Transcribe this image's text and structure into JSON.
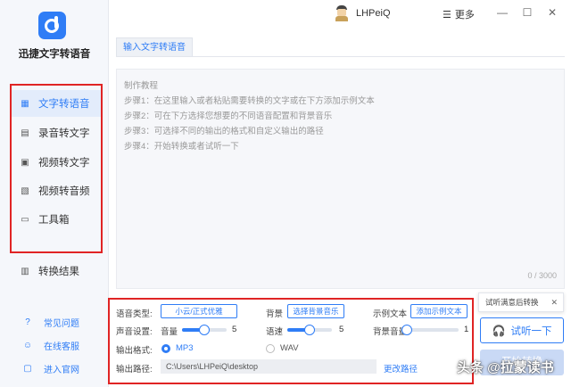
{
  "app": {
    "name": "迅捷文字转语音",
    "accent_color": "#2f7df6",
    "highlight_box_color": "#e02424"
  },
  "header": {
    "username": "LHPeiQ",
    "more_label": "更多",
    "icons": [
      "avatar",
      "menu-icon",
      "minimize-icon",
      "maximize-icon",
      "close-icon"
    ]
  },
  "sidebar": {
    "items": [
      {
        "label": "文字转语音",
        "icon": "text-to-speech-icon",
        "active": true
      },
      {
        "label": "录音转文字",
        "icon": "recording-icon",
        "active": false
      },
      {
        "label": "视频转文字",
        "icon": "video-text-icon",
        "active": false
      },
      {
        "label": "视频转音频",
        "icon": "video-audio-icon",
        "active": false
      },
      {
        "label": "工具箱",
        "icon": "toolbox-icon",
        "active": false
      }
    ],
    "result_label": "转换结果",
    "links": [
      {
        "label": "常见问题",
        "icon": "question-icon"
      },
      {
        "label": "在线客服",
        "icon": "service-icon"
      },
      {
        "label": "进入官网",
        "icon": "website-icon"
      }
    ]
  },
  "tab": {
    "label": "输入文字转语音"
  },
  "editor": {
    "placeholder_lines": [
      "制作教程",
      "步骤1：在这里输入或者粘贴需要转换的文字或在下方添加示例文本",
      "步骤2：可在下方选择您想要的不同语音配置和背景音乐",
      "步骤3：可选择不同的输出的格式和自定义输出的路径",
      "步骤4：开始转换或者试听一下"
    ],
    "counter": "0 / 3000"
  },
  "settings": {
    "voice_type_label": "语音类型:",
    "voice_type_value": "小云/正式优雅",
    "bg_label": "背景",
    "bg_button": "选择背景音乐",
    "sample_label": "示例文本",
    "sample_button": "添加示例文本",
    "sound_label": "声音设置:",
    "volume_label": "音量",
    "volume_value": "5",
    "volume_fraction": 0.5,
    "speed_label": "语速",
    "speed_value": "5",
    "speed_fraction": 0.5,
    "bg_volume_label": "背景音量",
    "bg_volume_value": "1",
    "bg_volume_fraction": 0.0,
    "format_label": "输出格式:",
    "format_options": [
      "MP3",
      "WAV"
    ],
    "format_selected": "MP3",
    "path_label": "输出路径:",
    "path_value": "C:\\Users\\LHPeiQ\\desktop",
    "change_path": "更改路径"
  },
  "actions": {
    "tooltip": "试听满意后转换",
    "listen_label": "试听一下",
    "start_label": "开始转换"
  },
  "watermark": "头条 @拉蒙读书"
}
